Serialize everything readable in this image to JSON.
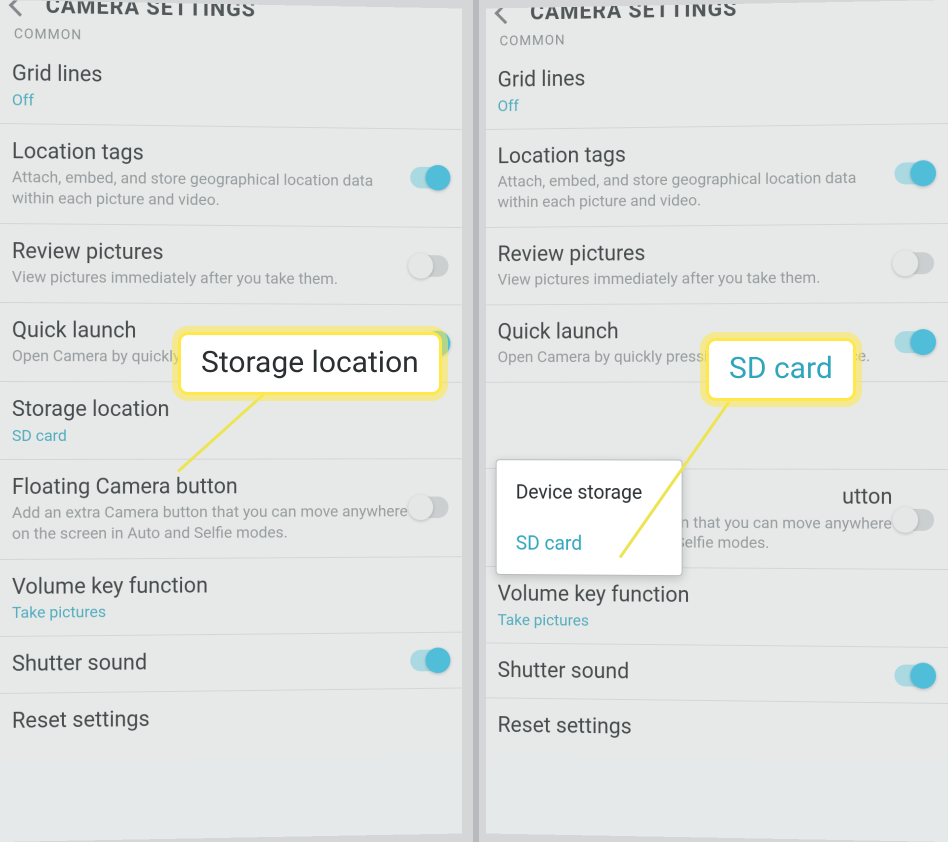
{
  "left": {
    "header_title": "CAMERA SETTINGS",
    "section": "COMMON",
    "items": {
      "grid": {
        "title": "Grid lines",
        "value": "Off"
      },
      "location": {
        "title": "Location tags",
        "sub": "Attach, embed, and store geographical location data within each picture and video.",
        "toggle": true
      },
      "review": {
        "title": "Review pictures",
        "sub": "View pictures immediately after you take them.",
        "toggle": false
      },
      "quick": {
        "title": "Quick launch",
        "sub": "Open Camera by quickly pressing the Home key twice.",
        "toggle": true
      },
      "storage": {
        "title": "Storage location",
        "value": "SD card"
      },
      "floating": {
        "title": "Floating Camera button",
        "sub": "Add an extra Camera button that you can move anywhere on the screen in Auto and Selfie modes.",
        "toggle": false
      },
      "volume": {
        "title": "Volume key function",
        "value": "Take pictures"
      },
      "shutter": {
        "title": "Shutter sound",
        "toggle": true
      },
      "reset": {
        "title": "Reset settings"
      }
    },
    "callout": "Storage location"
  },
  "right": {
    "header_title": "CAMERA SETTINGS",
    "section": "COMMON",
    "items": {
      "grid": {
        "title": "Grid lines",
        "value": "Off"
      },
      "location": {
        "title": "Location tags",
        "sub": "Attach, embed, and store geographical location data within each picture and video.",
        "toggle": true
      },
      "review": {
        "title": "Review pictures",
        "sub": "View pictures immediately after you take them.",
        "toggle": false
      },
      "quick": {
        "title": "Quick launch",
        "sub": "Open Camera by quickly pressing the Home key twice.",
        "toggle": true
      },
      "floating": {
        "title": "Floating Camera button",
        "sub": "Add an extra Camera button that you can move anywhere on the screen in Auto and Selfie modes.",
        "toggle": false
      },
      "volume": {
        "title": "Volume key function",
        "value": "Take pictures"
      },
      "shutter": {
        "title": "Shutter sound",
        "toggle": true
      },
      "reset": {
        "title": "Reset settings"
      }
    },
    "popup": {
      "opt1": "Device storage",
      "opt2": "SD card"
    },
    "callout": "SD card"
  }
}
